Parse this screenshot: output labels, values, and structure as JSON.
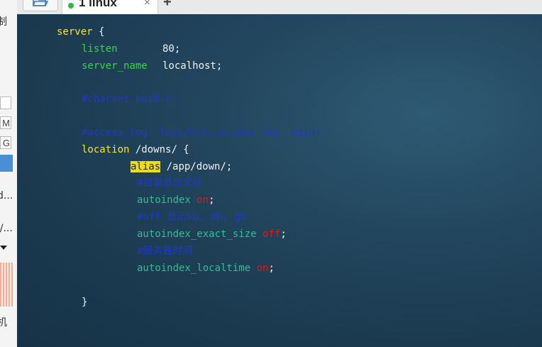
{
  "sidebar": {
    "fragments": [
      "制",
      "M",
      "G",
      "d...",
      "r/...",
      "机"
    ]
  },
  "tabbar": {
    "tab_label": "1 linux",
    "close_glyph": "×",
    "add_glyph": "+",
    "status_color": "#2db84b"
  },
  "terminal": {
    "l1_kw": "server",
    "l1_rest": " {",
    "l2_dir": "listen",
    "l2_val": "80;",
    "l3_dir": "server_name",
    "l3_val": "localhost;",
    "l5_cm": "#charset koi8-r;",
    "l7_cm": "#access_log  logs/host.access.log  main;",
    "l8_kw": "location",
    "l8_rest": " /downs/ {",
    "l9_hl": "alias",
    "l9_rest": " /app/down/;",
    "l10_cm": "#目录显示文件",
    "l11_tl": "autoindex",
    "l11_val": "on",
    "l11_end": ";",
    "l12_cm": "#off 显示kb, mb, gb",
    "l13_tl": "autoindex_exact_size",
    "l13_val": "off",
    "l13_end": ";",
    "l14_cm": "#服务器时间",
    "l15_tl": "autoindex_localtime",
    "l15_val": "on",
    "l15_end": ";",
    "l17_close": "}"
  }
}
